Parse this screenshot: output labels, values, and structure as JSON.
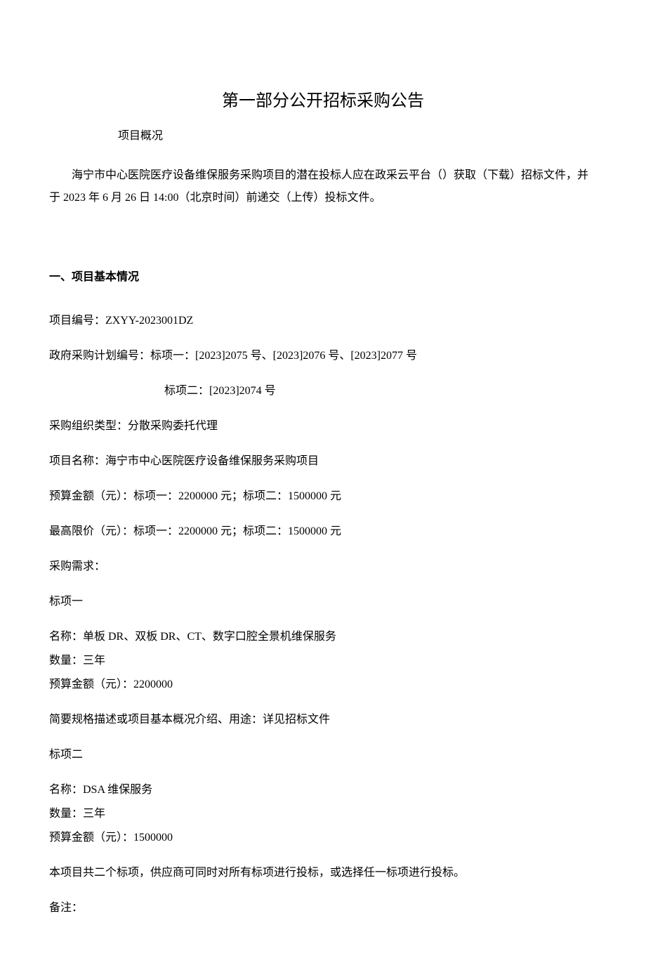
{
  "title": "第一部分公开招标采购公告",
  "overview_label": "项目概况",
  "overview_text": "海宁市中心医院医疗设备维保服务采购项目的潜在投标人应在政采云平台（）获取（下载）招标文件，并于 2023 年 6 月 26 日 14:00（北京时间）前递交（上传）投标文件。",
  "section1_heading": "一、项目基本情况",
  "project_number": "项目编号：ZXYY-2023001DZ",
  "plan_number_line1": "政府采购计划编号：标项一：[2023]2075 号、[2023]2076 号、[2023]2077 号",
  "plan_number_line2": "标项二：[2023]2074 号",
  "org_type": "采购组织类型：分散采购委托代理",
  "project_name": "项目名称：海宁市中心医院医疗设备维保服务采购项目",
  "budget": "预算金额（元）：标项一：2200000 元；标项二：1500000 元",
  "max_price": "最高限价（元）：标项一：2200000 元；标项二：1500000 元",
  "requirements_label": "采购需求：",
  "lot1": {
    "label": "标项一",
    "name": "名称：单板 DR、双板 DR、CT、数字口腔全景机维保服务",
    "quantity": "数量：三年",
    "budget": "预算金额（元）：2200000"
  },
  "description": "简要规格描述或项目基本概况介绍、用途：详见招标文件",
  "lot2": {
    "label": "标项二",
    "name": "名称：DSA 维保服务",
    "quantity": "数量：三年",
    "budget": "预算金额（元）：1500000"
  },
  "supplier_note": "本项目共二个标项，供应商可同时对所有标项进行投标，或选择任一标项进行投标。",
  "remarks_label": "备注："
}
